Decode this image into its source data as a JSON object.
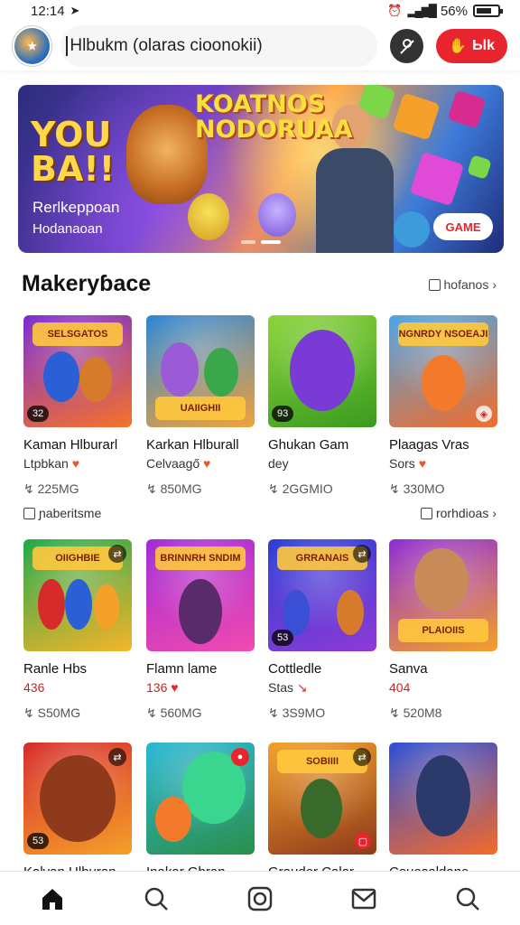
{
  "status_bar": {
    "time": "12:14",
    "battery": "56%"
  },
  "header": {
    "search_value": "Hlbukm (olaras cioonokii)",
    "live_label": "Ьlk"
  },
  "banner": {
    "big_text": "YOU BA!!",
    "title": "KOATNOS NODORUAA",
    "subtitle_1": "Rerlkeppoan",
    "subtitle_2": "Hodanaoan",
    "cta": "GAME"
  },
  "section": {
    "title": "Makeryɓace",
    "link": "hofanos"
  },
  "rows": [
    {
      "meta_left": "ɲaberitsme",
      "meta_right": "rorhdioas",
      "cards": [
        {
          "banner": "SELSGATOS",
          "badge": "32",
          "name": "Kaman Hlburarl",
          "sub": "Ltpbkan",
          "heart": "♥",
          "size": "225MG",
          "c1": "#7b2bd6",
          "c2": "#f5732a"
        },
        {
          "banner": "UAIIGHII",
          "badge": "",
          "name": "Karkan Hlburall",
          "sub": "Celvaagő",
          "heart": "♥",
          "size": "850MG",
          "c1": "#2b86d6",
          "c2": "#f2a23a"
        },
        {
          "banner": "",
          "badge": "93",
          "name": "Ghukan Gam",
          "sub": "dey",
          "heart": "",
          "size": "2GGMIO",
          "c1": "#8ad43a",
          "c2": "#3a9b1f"
        },
        {
          "banner": "NGNRDY NSOEAJI",
          "badge": "",
          "name": "Plaagas Vras",
          "sub": "Sors",
          "heart": "♥",
          "size": "330MO",
          "c1": "#4aa5e8",
          "c2": "#f26d2a"
        }
      ]
    },
    {
      "meta_left": "",
      "meta_right": "",
      "cards": [
        {
          "banner": "OIIGHBIE",
          "badge": "",
          "name": "Ranle Hbs",
          "sub": "436",
          "heart": "",
          "size": "S50MG",
          "c1": "#1fa84a",
          "c2": "#f5b52a"
        },
        {
          "banner": "BRINNRH SNDIM",
          "badge": "",
          "name": "Flamn lame",
          "sub": "136",
          "heart": "♥",
          "size": "560MG",
          "c1": "#a12bd6",
          "c2": "#f24ab0"
        },
        {
          "banner": "GRRANAIS",
          "badge": "53",
          "name": "Cottledle",
          "sub": "Stas",
          "heart": "↘",
          "size": "3S9MO",
          "c1": "#2b3fd6",
          "c2": "#8f3ad6"
        },
        {
          "banner": "PLAIOIIS",
          "badge": "",
          "name": "Sanva",
          "sub": "404",
          "heart": "",
          "size": "520M8",
          "c1": "#8f2bd6",
          "c2": "#f5a02a"
        }
      ]
    },
    {
      "meta_left": "",
      "meta_right": "",
      "cards": [
        {
          "banner": "",
          "badge": "53",
          "name": "Kalvan Hlburan",
          "sub": "",
          "heart": "",
          "size": "",
          "c1": "#d62b2b",
          "c2": "#f5a02a"
        },
        {
          "banner": "",
          "badge": "",
          "name": "Inakar Gbran",
          "sub": "",
          "heart": "",
          "size": "",
          "c1": "#2bb8d6",
          "c2": "#2b8f4a"
        },
        {
          "banner": "SOBIIII",
          "badge": "",
          "name": "Grauder Calar",
          "sub": "",
          "heart": "",
          "size": "",
          "c1": "#f5a02a",
          "c2": "#8f3a1a"
        },
        {
          "banner": "",
          "badge": "",
          "name": "Couesaldane",
          "sub": "",
          "heart": "",
          "size": "",
          "c1": "#2b4fd6",
          "c2": "#f56a2a"
        }
      ]
    }
  ],
  "nav": [
    "home-icon",
    "search-icon",
    "instagram-icon",
    "inbox-icon",
    "search-icon"
  ]
}
